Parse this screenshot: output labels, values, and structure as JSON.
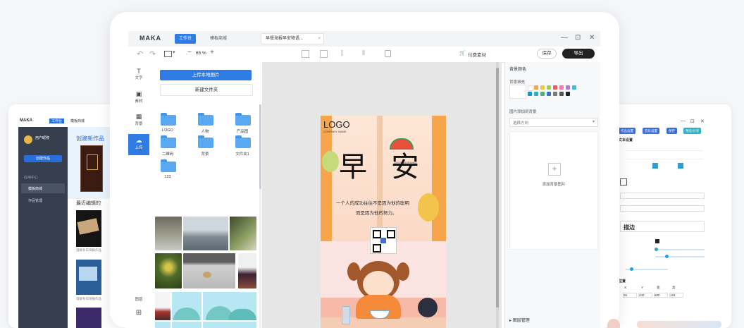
{
  "main": {
    "app_title": "MAKA",
    "tabs": [
      {
        "label": "工作台"
      },
      {
        "label": "模板商城"
      },
      {
        "label": "早餐海报早安物语..."
      }
    ],
    "window_controls": {
      "minimize": "—",
      "maximize": "⊡",
      "close": "✕"
    },
    "toolbar": {
      "undo": "↶",
      "redo": "↷",
      "zoom_minus": "−",
      "zoom_value": "65 %",
      "zoom_plus": "+",
      "buy_material": "付费素材",
      "save": "保存",
      "export": "导出"
    },
    "rail": [
      {
        "glyph": "T",
        "label": "文字"
      },
      {
        "glyph": "▣",
        "label": "素材"
      },
      {
        "glyph": "▦",
        "label": "背景"
      },
      {
        "glyph": "☁",
        "label": "上传"
      }
    ],
    "rail_bottom": {
      "label": "图层",
      "qr": "⊞"
    },
    "panel": {
      "upload_button": "上传本地图片",
      "new_folder_button": "新建文件夹",
      "folders": [
        {
          "label": "LOGO"
        },
        {
          "label": "人物"
        },
        {
          "label": "产品图"
        },
        {
          "label": "二维码"
        },
        {
          "label": "背景"
        },
        {
          "label": "文件夹1"
        },
        {
          "label": "123"
        }
      ]
    },
    "poster": {
      "logo": "LOGO",
      "company": "COMPANY NAME",
      "headline_1": "早",
      "headline_2": "安",
      "slogan_1": "一个人的成功往往不是因为他的聪明",
      "slogan_2": "而是因为他的努力。",
      "small_caption": "GOOD MORNING"
    },
    "props": {
      "title": "背景颜色",
      "fill_label": "背景填充",
      "colors": [
        "#ffffff",
        "#f7a44a",
        "#f4c542",
        "#a2cf5d",
        "#ef5c5c",
        "#f07aa7",
        "#b479e0",
        "#3dbdde",
        "#1e90d6",
        "#2db1c6",
        "#4cb07a",
        "#3f72c7",
        "#777777",
        "#555555",
        "#222222"
      ],
      "image_section": "图片添加到背景",
      "select_value": "选择方向",
      "add_image": "添加背景图片",
      "layers": "图层管理"
    }
  },
  "left_window": {
    "app_title": "MAKA",
    "tabs": [
      {
        "label": "工作台"
      },
      {
        "label": "模板商城"
      }
    ],
    "user_name": "用户昵称",
    "create_btn": "创建作品",
    "menu": [
      {
        "label": "应用中心"
      },
      {
        "label": "模板商城"
      },
      {
        "label": "作品管理"
      }
    ],
    "create_title": "创建新作品",
    "recent_title": "最近编辑的",
    "item_caption": "温暖冬日海报作品"
  },
  "right_window": {
    "buttons": [
      {
        "label": "作品设置"
      },
      {
        "label": "音乐设置"
      },
      {
        "label": "保存"
      },
      {
        "label": "预览/分享"
      }
    ],
    "text_settings": "文本设置",
    "text_label": "描边",
    "position_title": "位置",
    "pos_labels": [
      "X",
      "Y",
      "宽",
      "高"
    ],
    "pos_values": [
      "26",
      "442",
      "600",
      "124"
    ]
  }
}
